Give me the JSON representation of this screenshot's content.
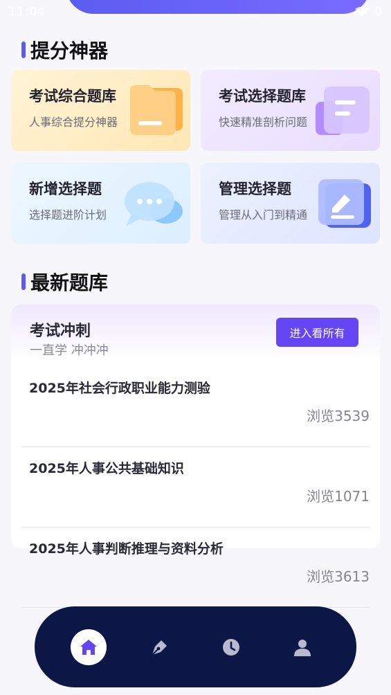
{
  "status_bar": {
    "time": "11:04",
    "battery": "0"
  },
  "section_tools": {
    "title": "提分神器"
  },
  "cards": [
    {
      "title": "考试综合题库",
      "subtitle": "人事综合提分神器",
      "icon": "folder-icon"
    },
    {
      "title": "考试选择题库",
      "subtitle": "快速精准剖析问题",
      "icon": "document-icon"
    },
    {
      "title": "新增选择题",
      "subtitle": "选择题进阶计划",
      "icon": "chat-bubble-icon"
    },
    {
      "title": "管理选择题",
      "subtitle": "管理从入门到精通",
      "icon": "edit-icon"
    }
  ],
  "section_latest": {
    "title": "最新题库"
  },
  "latest_panel": {
    "title": "考试冲刺",
    "subtitle": "一直学 冲冲冲",
    "enter_button": "进入看所有"
  },
  "exam_list": [
    {
      "title": "2025年社会行政职业能力测验",
      "views": "浏览3539"
    },
    {
      "title": "2025年人事公共基础知识",
      "views": "浏览1071"
    },
    {
      "title": "2025年人事判断推理与资料分析",
      "views": "浏览3613"
    }
  ],
  "bottom_nav": [
    {
      "icon": "home-icon",
      "active": true
    },
    {
      "icon": "pen-icon",
      "active": false
    },
    {
      "icon": "clock-icon",
      "active": false
    },
    {
      "icon": "user-icon",
      "active": false
    }
  ],
  "colors": {
    "accent": "#6446f5",
    "nav_bg": "#0d1745"
  }
}
